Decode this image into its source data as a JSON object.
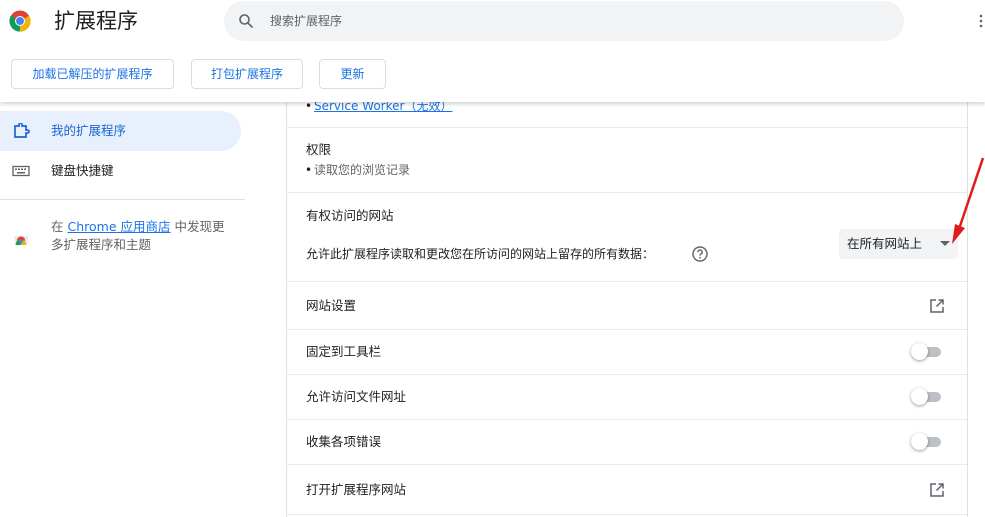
{
  "header": {
    "title": "扩展程序",
    "search_placeholder": "搜索扩展程序",
    "logo": "chrome-logo-icon"
  },
  "toolbar": {
    "load_unpacked": "加载已解压的扩展程序",
    "pack": "打包扩展程序",
    "update": "更新"
  },
  "sidebar": {
    "items": [
      {
        "label": "我的扩展程序",
        "icon": "puzzle-icon",
        "active": true
      },
      {
        "label": "键盘快捷键",
        "icon": "keyboard-icon",
        "active": false
      }
    ],
    "store": {
      "prefix": "在 ",
      "link": "Chrome 应用商店",
      "suffix": " 中发现更多扩展程序和主题",
      "icon": "webstore-icon"
    }
  },
  "details": {
    "service_worker_link": "Service Worker（无效）",
    "permissions_title": "权限",
    "permissions_item": "读取您的浏览记录",
    "site_access_title": "有权访问的网站",
    "site_access_desc": "允许此扩展程序读取和更改您在所访问的网站上留存的所有数据：",
    "site_access_value": "在所有网站上",
    "site_settings": "网站设置",
    "pin_toolbar": "固定到工具栏",
    "pin_toolbar_on": false,
    "file_urls": "允许访问文件网址",
    "file_urls_on": false,
    "collect_errors": "收集各项错误",
    "collect_errors_on": false,
    "open_website": "打开扩展程序网站"
  },
  "colors": {
    "accent": "#1a73e8",
    "active_nav_bg": "#e8f0fe",
    "annotation_arrow": "#e01b1b"
  }
}
